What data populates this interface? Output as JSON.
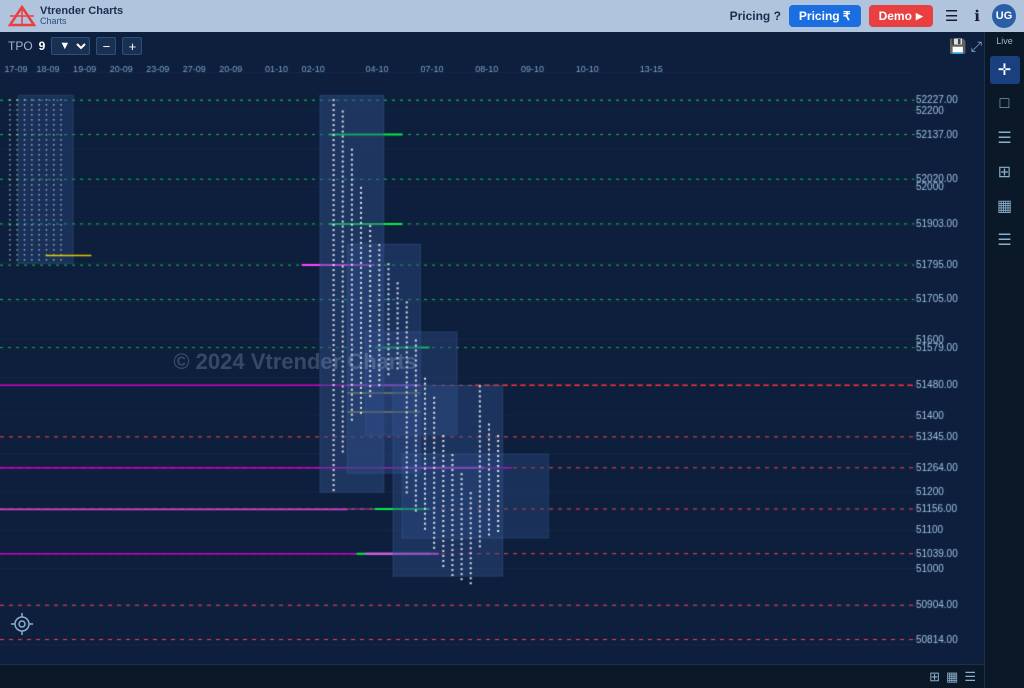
{
  "navbar": {
    "logo_text": "Vtrender\nCharts",
    "pricing_label": "Pricing ₹",
    "pricing_question": "?",
    "demo_label": "Demo",
    "nav_icons": [
      "☰",
      "ℹ"
    ],
    "avatar_label": "UG"
  },
  "toolbar": {
    "tpo_label": "TPO",
    "tpo_value": "9",
    "minus_label": "−",
    "plus_label": "+"
  },
  "chart_toolbar_right": {
    "save_icon": "💾",
    "expand_icon": "⤢"
  },
  "sidebar": {
    "live_label": "Live",
    "icons": [
      "□",
      "☰",
      "⊞",
      "▦",
      "☰"
    ]
  },
  "watermark": "© 2024 Vtrender Charts",
  "price_levels": [
    {
      "value": "52227.00",
      "y_pct": 3
    },
    {
      "value": "52200",
      "y_pct": 4
    },
    {
      "value": "52137.00",
      "y_pct": 9
    },
    {
      "value": "52020.00",
      "y_pct": 16
    },
    {
      "value": "52000",
      "y_pct": 17
    },
    {
      "value": "51903.00",
      "y_pct": 24
    },
    {
      "value": "51795.00",
      "y_pct": 31
    },
    {
      "value": "51705.00",
      "y_pct": 37
    },
    {
      "value": "51600",
      "y_pct": 43
    },
    {
      "value": "51579.00",
      "y_pct": 44
    },
    {
      "value": "51480.00",
      "y_pct": 51
    },
    {
      "value": "51400",
      "y_pct": 55
    },
    {
      "value": "51345.00",
      "y_pct": 59
    },
    {
      "value": "51264.00",
      "y_pct": 64
    },
    {
      "value": "51200",
      "y_pct": 67
    },
    {
      "value": "51156.00",
      "y_pct": 70
    },
    {
      "value": "51100",
      "y_pct": 72
    },
    {
      "value": "51039.00",
      "y_pct": 76
    },
    {
      "value": "51000",
      "y_pct": 78
    },
    {
      "value": "50904.00",
      "y_pct": 84
    },
    {
      "value": "50814.00",
      "y_pct": 89
    }
  ],
  "time_labels": [
    {
      "text": "17-09",
      "x_pct": 0.5
    },
    {
      "text": "18-09",
      "x_pct": 4
    },
    {
      "text": "19-09",
      "x_pct": 8
    },
    {
      "text": "20-09",
      "x_pct": 12
    },
    {
      "text": "23-09",
      "x_pct": 16
    },
    {
      "text": "27-09",
      "x_pct": 20
    },
    {
      "text": "20-09",
      "x_pct": 24
    },
    {
      "text": "01-10",
      "x_pct": 29
    },
    {
      "text": "02-10",
      "x_pct": 33
    },
    {
      "text": "04-10",
      "x_pct": 40
    },
    {
      "text": "07-10",
      "x_pct": 46
    },
    {
      "text": "08-10",
      "x_pct": 52
    },
    {
      "text": "09-10",
      "x_pct": 57
    },
    {
      "text": "10-10",
      "x_pct": 63
    },
    {
      "text": "13-15",
      "x_pct": 70
    }
  ],
  "bottom_bar": {
    "icons": [
      "⊞",
      "▦",
      "☰"
    ]
  }
}
